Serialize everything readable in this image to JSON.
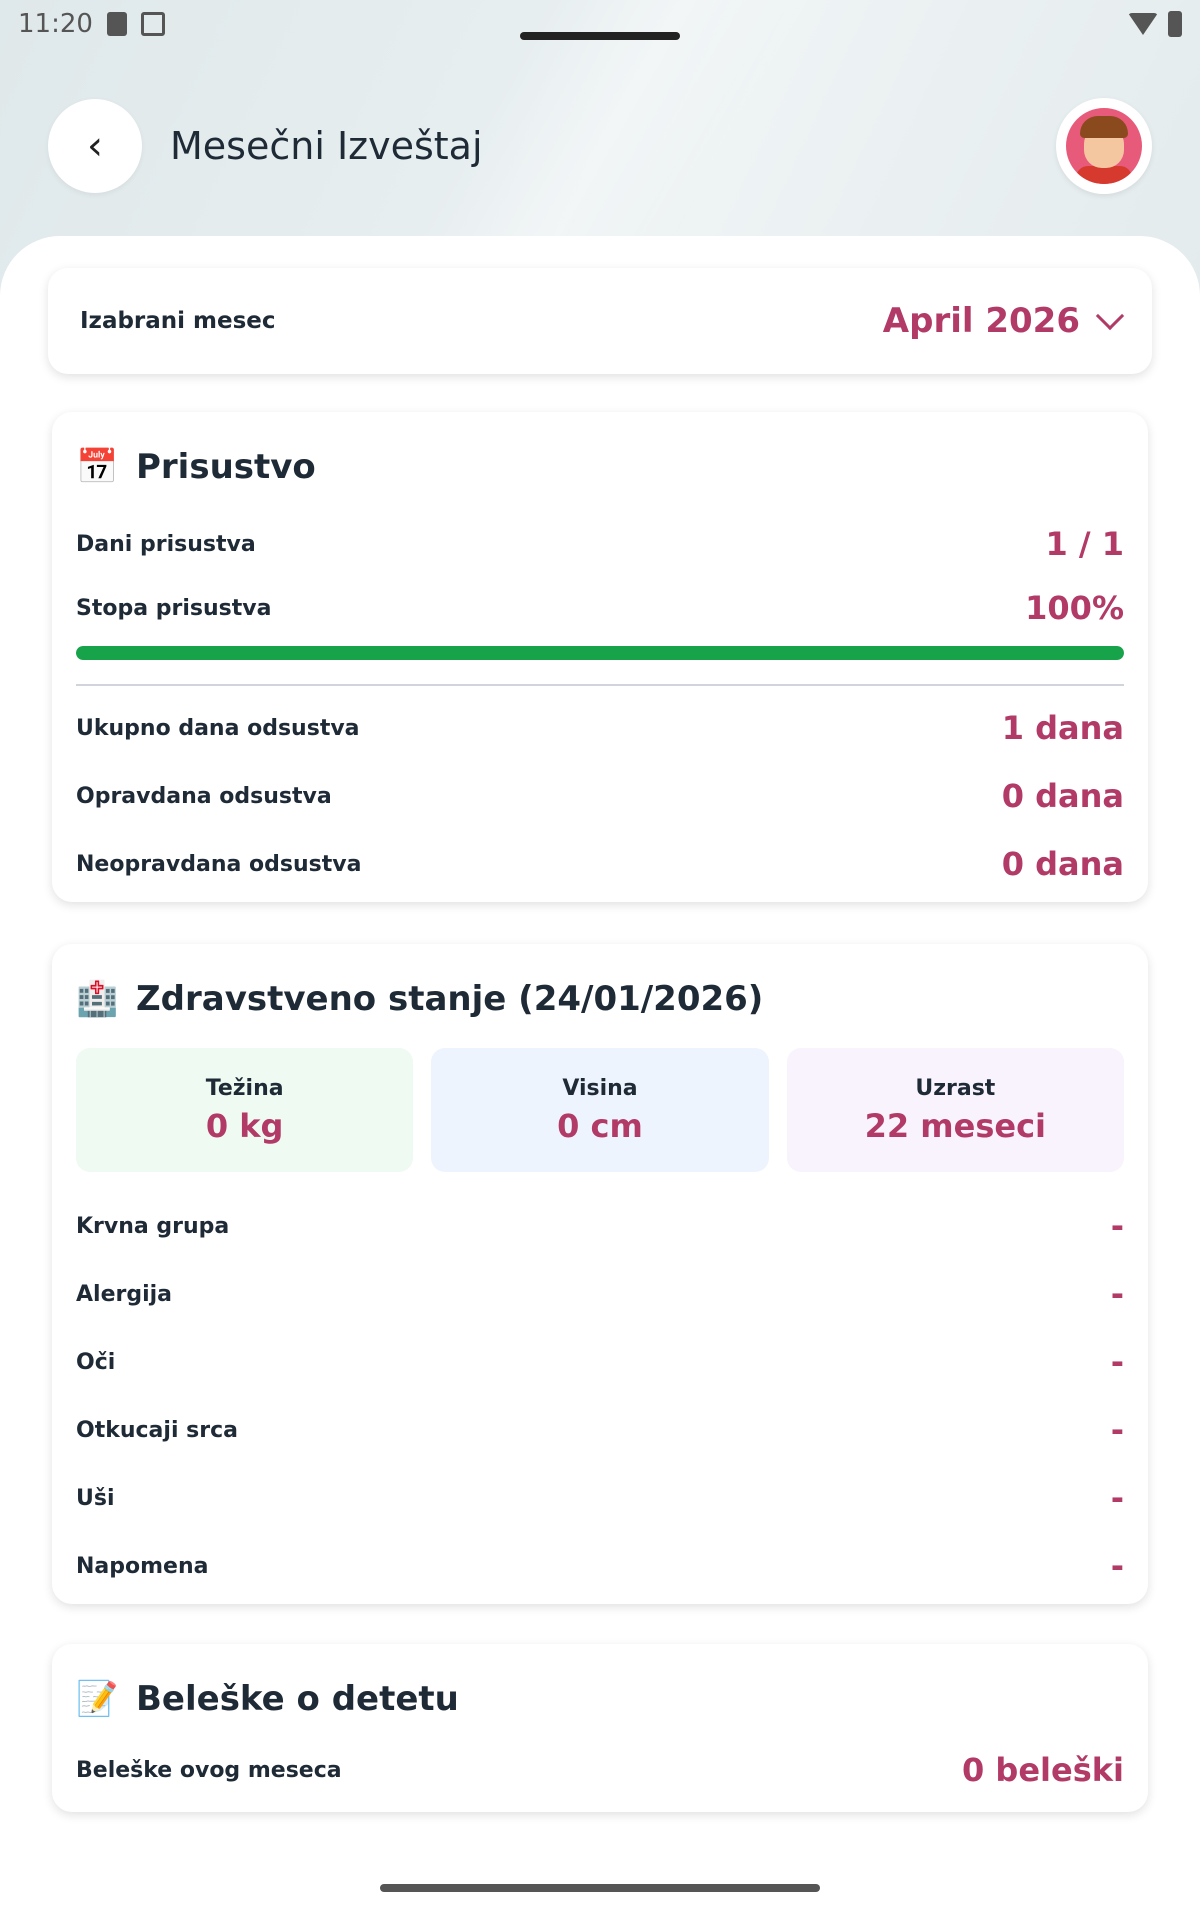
{
  "status": {
    "time": "11:20"
  },
  "header": {
    "title": "Mesečni Izveštaj",
    "back_icon": "‹"
  },
  "month": {
    "label": "Izabrani mesec",
    "value": "April 2026"
  },
  "attendance": {
    "icon": "📅",
    "title": "Prisustvo",
    "days_label": "Dani prisustva",
    "days_value": "1 / 1",
    "rate_label": "Stopa prisustva",
    "rate_value": "100%",
    "rate_fraction": 1.0,
    "total_absence_label": "Ukupno dana odsustva",
    "total_absence_value": "1 dana",
    "excused_label": "Opravdana odsustva",
    "excused_value": "0 dana",
    "unexcused_label": "Neopravdana odsustva",
    "unexcused_value": "0 dana"
  },
  "health": {
    "icon": "🏥",
    "title": "Zdravstveno stanje (24/01/2026)",
    "weight_label": "Težina",
    "weight_value": "0 kg",
    "height_label": "Visina",
    "height_value": "0 cm",
    "age_label": "Uzrast",
    "age_value": "22 meseci",
    "rows": [
      {
        "label": "Krvna grupa",
        "value": "-"
      },
      {
        "label": "Alergija",
        "value": "-"
      },
      {
        "label": "Oči",
        "value": "-"
      },
      {
        "label": "Otkucaji srca",
        "value": "-"
      },
      {
        "label": "Uši",
        "value": "-"
      },
      {
        "label": "Napomena",
        "value": "-"
      }
    ]
  },
  "notes": {
    "icon": "📝",
    "title": "Beleške o detetu",
    "label": "Beleške ovog meseca",
    "value": "0 beleški"
  },
  "colors": {
    "accent": "#b23a67",
    "progress": "#16a34a"
  }
}
